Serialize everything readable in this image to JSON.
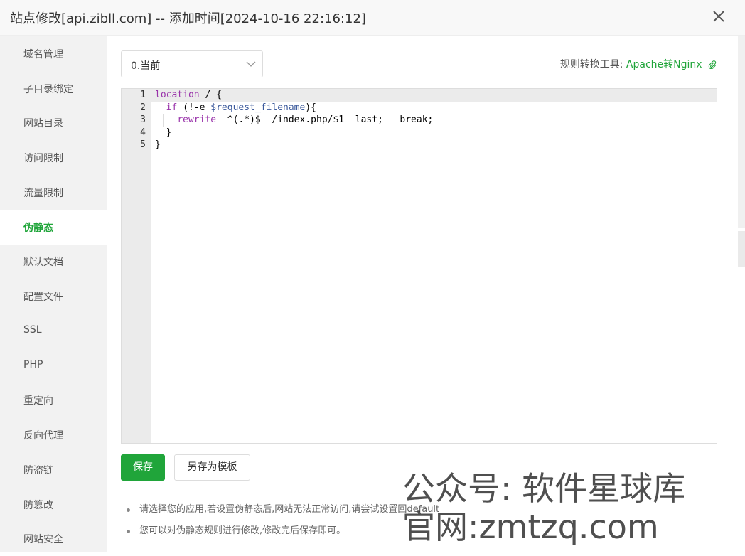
{
  "window": {
    "title": "站点修改[api.zibll.com] -- 添加时间[2024-10-16 22:16:12]",
    "close_icon": "close-icon"
  },
  "sidebar": {
    "items": [
      {
        "label": "域名管理"
      },
      {
        "label": "子目录绑定"
      },
      {
        "label": "网站目录"
      },
      {
        "label": "访问限制"
      },
      {
        "label": "流量限制"
      },
      {
        "label": "伪静态",
        "active": true
      },
      {
        "label": "默认文档"
      },
      {
        "label": "配置文件"
      },
      {
        "label": "SSL"
      },
      {
        "label": "PHP"
      },
      {
        "label": "重定向"
      },
      {
        "label": "反向代理"
      },
      {
        "label": "防盗链"
      },
      {
        "label": "防篡改"
      },
      {
        "label": "网站安全"
      }
    ]
  },
  "rewrite": {
    "selected": "0.当前",
    "tool_label": "规则转换工具:",
    "tool_link": "Apache转Nginx",
    "link_icon": "paperclip-icon"
  },
  "editor": {
    "line_numbers": [
      "1",
      "2",
      "3",
      "4",
      "5"
    ],
    "lines": [
      "location / {",
      "  if (!-e $request_filename){",
      "    rewrite  ^(.*)$  /index.php/$1  last;   break;",
      "  }",
      "}"
    ]
  },
  "actions": {
    "save_label": "保存",
    "save_template_label": "另存为模板"
  },
  "tips": [
    "请选择您的应用,若设置伪静态后,网站无法正常访问,请尝试设置回default",
    "您可以对伪静态规则进行修改,修改完后保存即可。"
  ],
  "watermark": {
    "line1": "公众号: 软件星球库",
    "line2": "官网:zmtzq.com"
  },
  "colors": {
    "accent": "#20a53a",
    "keyword": "#9933aa",
    "variable": "#3c5a9c"
  }
}
